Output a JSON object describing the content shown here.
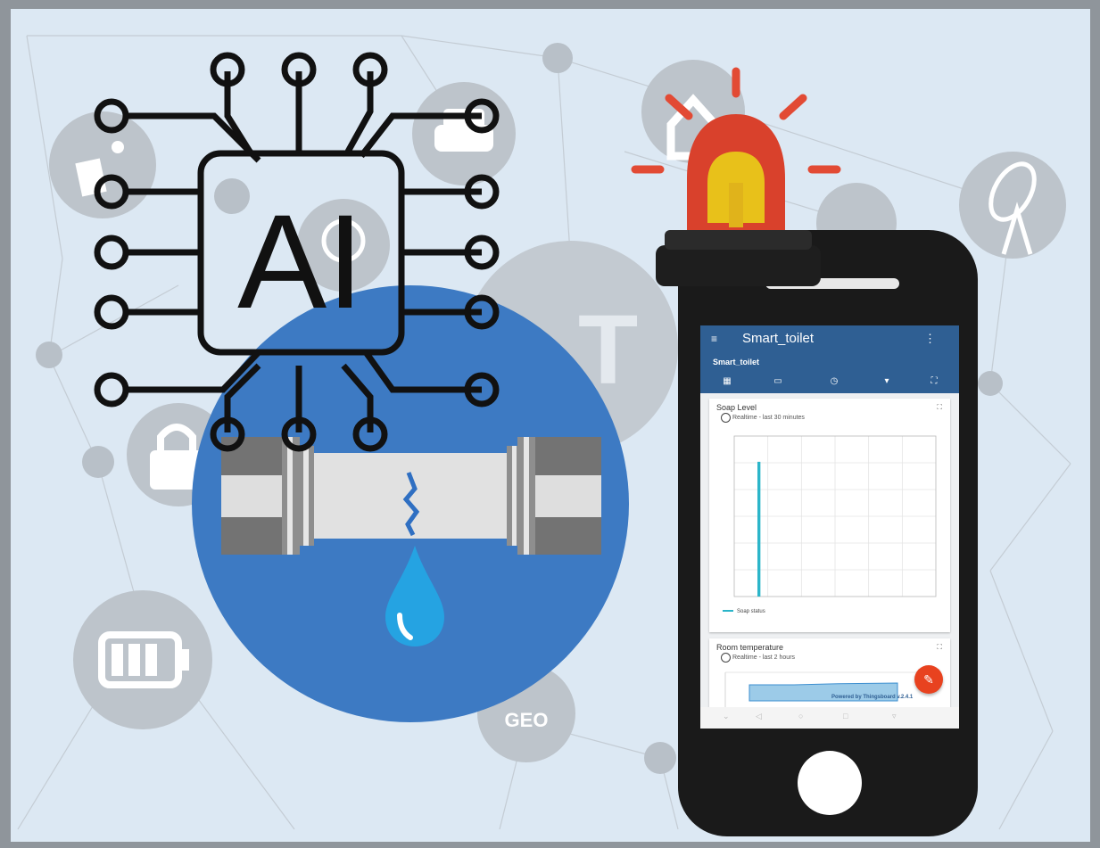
{
  "background": {
    "color": "#dce8f3",
    "node_color": "#b6bec6"
  },
  "icons": [
    "solar-panel-icon",
    "car-icon",
    "home-icon",
    "satellite-dish-icon",
    "lock-icon",
    "battery-icon",
    "lightbulb-icon",
    "geo-icon",
    "ai-chip-icon",
    "leaking-pipe-icon",
    "water-drop-icon",
    "alarm-siren-icon",
    "smartphone-icon"
  ],
  "ai_chip": {
    "label": "AI"
  },
  "iot_text": "IoT",
  "geo_label": "GEO",
  "colors": {
    "leak_circle": "#3d7ac3",
    "siren": "#d9412c",
    "siren_glass": "#e8c11a",
    "phone_body": "#1a1a1a",
    "app_bar": "#2f5f93",
    "fab": "#e8421f",
    "chart_line": "#2bb5c9"
  },
  "app": {
    "title": "Smart_toilet",
    "menu_icon": "≡",
    "more_icon": "⋮",
    "subtitle": "Smart_toilet",
    "tabs": [
      "dashboard-icon",
      "chart-icon",
      "alarm-icon",
      "device-icon",
      "fullscreen-icon"
    ],
    "soap_card": {
      "title": "Soap Level",
      "realtime": "Realtime - last 30 minutes",
      "legend": "Soap status"
    },
    "temp_card": {
      "title": "Room temperature",
      "realtime": "Realtime - last 2 hours"
    },
    "footer_note": "Powered by Thingsboard v.2.4.1",
    "fab_icon": "✎"
  },
  "chart_data": [
    {
      "type": "line",
      "title": "Soap Level",
      "series": [
        {
          "name": "Soap status",
          "x": [
            0.12,
            0.12,
            0.125,
            0.125
          ],
          "y": [
            0,
            1,
            1,
            0
          ]
        }
      ],
      "xlim": [
        0,
        1
      ],
      "ylim": [
        0,
        1.2
      ],
      "grid": true,
      "legend": "bottom-left"
    },
    {
      "type": "area",
      "title": "Room temperature",
      "series": [
        {
          "x": [
            0,
            0.3,
            0.6,
            1.0
          ],
          "y": [
            20,
            20,
            20.3,
            20.5
          ]
        }
      ],
      "grid": true
    }
  ]
}
